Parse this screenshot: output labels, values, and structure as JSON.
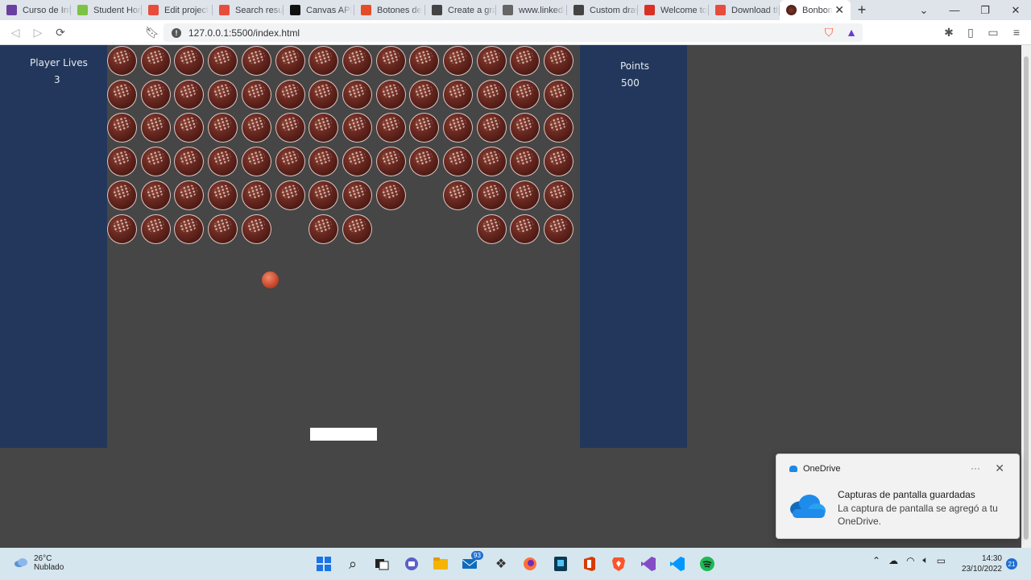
{
  "browser": {
    "tabs": [
      {
        "title": "Curso de Intr",
        "icon": "purple-logo-icon",
        "color": "#6b3fa0"
      },
      {
        "title": "Student Hom",
        "icon": "green-diamond-icon",
        "color": "#7cc243"
      },
      {
        "title": "Edit project",
        "icon": "red-app-icon",
        "color": "#e74c3c"
      },
      {
        "title": "Search result",
        "icon": "red-app-icon",
        "color": "#e74c3c"
      },
      {
        "title": "Canvas API",
        "icon": "medium-m-icon",
        "color": "#111111"
      },
      {
        "title": "Botones de",
        "icon": "html5-icon",
        "color": "#e44d26"
      },
      {
        "title": "Create a gra",
        "icon": "document-icon",
        "color": "#444444"
      },
      {
        "title": "www.linkedi",
        "icon": "linkedin-icon",
        "color": "#666666"
      },
      {
        "title": "Custom draw",
        "icon": "document-icon",
        "color": "#444444"
      },
      {
        "title": "Welcome to",
        "icon": "gmail-icon",
        "color": "#d93025"
      },
      {
        "title": "Download th",
        "icon": "red-app-icon",
        "color": "#e74c3c"
      }
    ],
    "active_tab": {
      "title": "Bonbon",
      "icon": "bonbon-icon"
    },
    "url": "127.0.0.1:5500/index.html"
  },
  "game": {
    "lives_label": "Player Lives",
    "lives_value": "3",
    "points_label": "Points",
    "points_value": "500",
    "bonbon_rows": [
      [
        1,
        1,
        1,
        1,
        1,
        1,
        1,
        1,
        1,
        1,
        1,
        1,
        1,
        1
      ],
      [
        1,
        1,
        1,
        1,
        1,
        1,
        1,
        1,
        1,
        1,
        1,
        1,
        1,
        1
      ],
      [
        1,
        1,
        1,
        1,
        1,
        1,
        1,
        1,
        1,
        1,
        1,
        1,
        1,
        1
      ],
      [
        1,
        1,
        1,
        1,
        1,
        1,
        1,
        1,
        1,
        1,
        1,
        1,
        1,
        1
      ],
      [
        1,
        1,
        1,
        1,
        1,
        1,
        1,
        1,
        1,
        0,
        1,
        1,
        1,
        1
      ],
      [
        1,
        1,
        1,
        1,
        1,
        0,
        1,
        1,
        0,
        0,
        0,
        1,
        1,
        1
      ]
    ],
    "colors": {
      "panel": "#22375b",
      "board": "#464646",
      "ball": "#c8472c",
      "paddle": "#ffffff"
    }
  },
  "toast": {
    "app": "OneDrive",
    "title": "Capturas de pantalla guardadas",
    "body": "La captura de pantalla se agregó a tu OneDrive."
  },
  "taskbar": {
    "temperature": "26°C",
    "condition": "Nublado",
    "mail_badge": "93",
    "time": "14:30",
    "date": "23/10/2022",
    "notification_count": "21"
  }
}
